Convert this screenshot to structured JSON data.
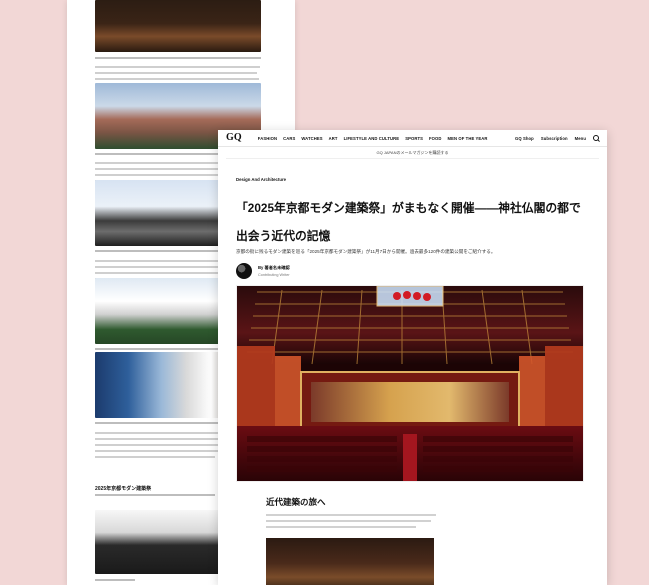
{
  "site": {
    "logo": "GQ",
    "nav": [
      "FASHION",
      "CARS",
      "WATCHES",
      "ART",
      "LIFESTYLE AND CULTURE",
      "SPORTS",
      "FOOD",
      "MEN OF THE YEAR"
    ],
    "right_links": [
      "GQ Shop",
      "Subscription",
      "Menu"
    ],
    "subbar_text": "GQ JAPANのメールマガジンを購読する"
  },
  "article": {
    "kicker": "Design And Architecture",
    "title_line1": "「2025年京都モダン建築祭」がまもなく開催――神社仏閣の都で",
    "title_line2": "出会う近代の記憶",
    "dek": "京都の街に残るモダン建築を巡る「2025年京都モダン建築祭」が11月7日から開催。過去最多120件の建築公開をご紹介する。",
    "author": "By 著者名未確認",
    "author_role": "Contributing Writer",
    "section_title": "近代建築の旅へ"
  },
  "left_page": {
    "small_title": "2025年京都モダン建築祭"
  },
  "colors": {
    "background": "#f2d7d6",
    "theatre_red": "#a4161f",
    "stage_gold": "#d6a24e"
  }
}
